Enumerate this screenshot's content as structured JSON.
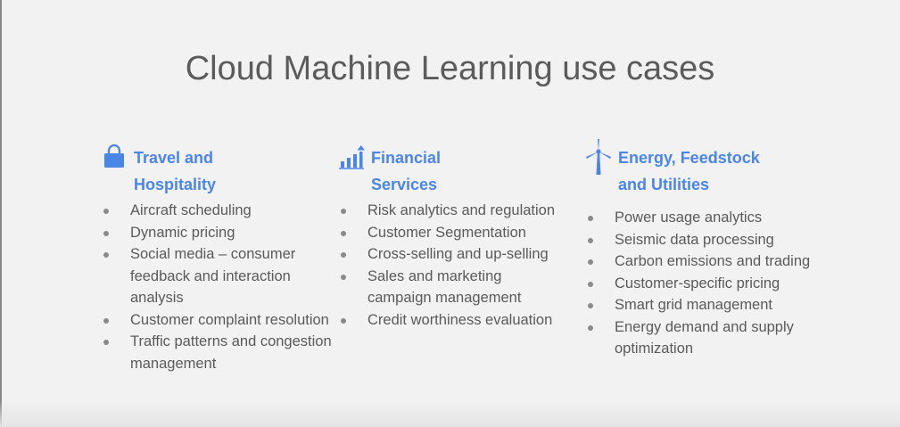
{
  "slide": {
    "title": "Cloud Machine Learning use cases",
    "accent_color": "#4a86e8",
    "columns": [
      {
        "icon": "shopping-bag-icon",
        "heading": "Travel and Hospitality",
        "items": [
          "Aircraft scheduling",
          "Dynamic pricing",
          "Social media – consumer feedback and interaction analysis",
          "Customer complaint resolution",
          "Traffic patterns and congestion management"
        ]
      },
      {
        "icon": "bar-chart-icon",
        "heading": "Financial Services",
        "items": [
          "Risk analytics and regulation",
          "Customer Segmentation",
          "Cross-selling and up-selling",
          "Sales and marketing campaign management",
          "Credit worthiness evaluation"
        ]
      },
      {
        "icon": "wind-turbine-icon",
        "heading": "Energy, Feedstock and Utilities",
        "items": [
          "Power usage analytics",
          "Seismic data processing",
          "Carbon emissions and trading",
          "Customer-specific pricing",
          "Smart grid management",
          "Energy demand and supply optimization"
        ]
      }
    ]
  }
}
